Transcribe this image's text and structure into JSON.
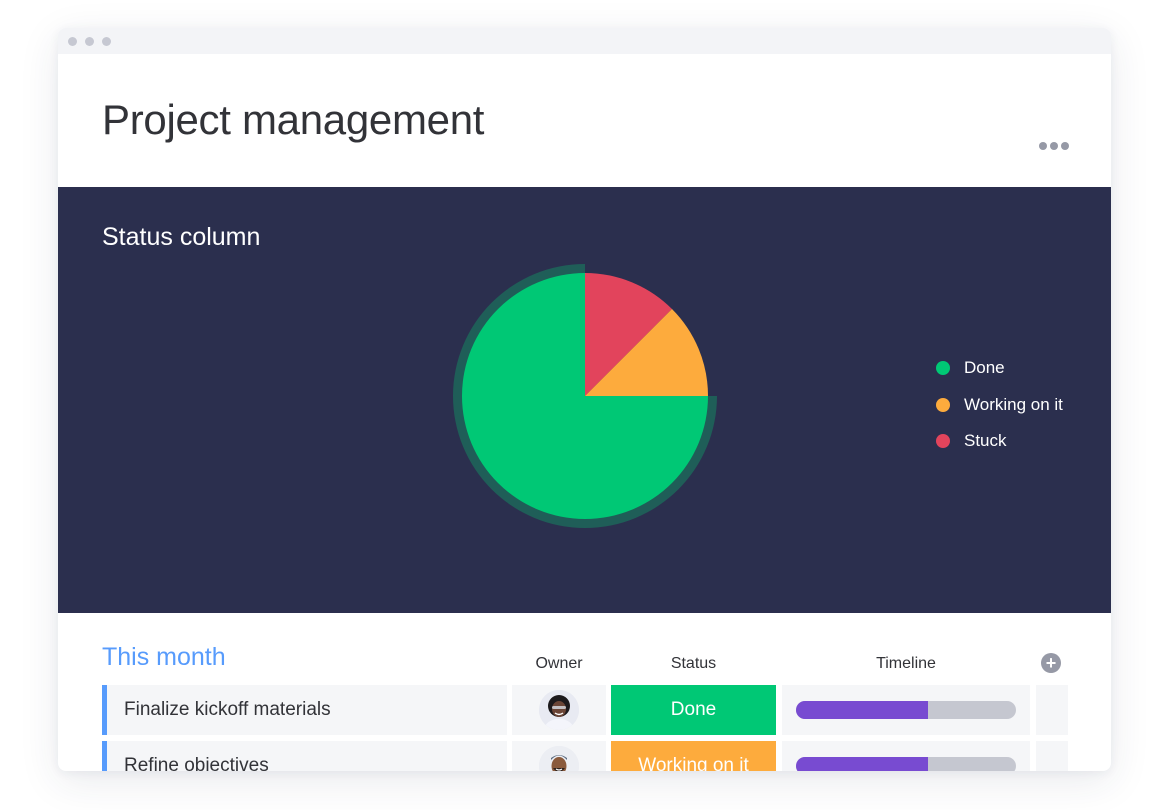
{
  "window": {
    "title_dots": 3
  },
  "header": {
    "title": "Project management",
    "more_icon": "ellipsis-icon"
  },
  "dashboard": {
    "widget_title": "Status column"
  },
  "chart_data": {
    "type": "pie",
    "title": "Status column",
    "categories": [
      "Done",
      "Working on it",
      "Stuck"
    ],
    "values": [
      75,
      12.5,
      12.5
    ],
    "unit": "percent",
    "colors": [
      "#00c875",
      "#fdab3d",
      "#e2445c"
    ],
    "highlighted": "Done",
    "highlight_ring_color": "#1f5e58",
    "start_angle": "12 o'clock",
    "direction": "counter-clockwise from Stuck: Stuck, Working on it, Done",
    "legend": {
      "placement": "right",
      "entries": [
        {
          "label": "Done",
          "color": "#00c875"
        },
        {
          "label": "Working on it",
          "color": "#fdab3d"
        },
        {
          "label": "Stuck",
          "color": "#e2445c"
        }
      ]
    }
  },
  "board": {
    "group_title": "This month",
    "group_color": "#579bfc",
    "columns": {
      "owner": "Owner",
      "status": "Status",
      "timeline": "Timeline"
    },
    "add_column_icon": "plus-circle-icon",
    "rows": [
      {
        "name": "Finalize kickoff materials",
        "owner": "avatar-woman",
        "status": "Done",
        "status_color": "#00c875",
        "timeline_progress": 0.6
      },
      {
        "name": "Refine objectives",
        "owner": "avatar-man",
        "status": "Working on it",
        "status_color": "#fdab3d",
        "timeline_progress": 0.6
      }
    ]
  }
}
